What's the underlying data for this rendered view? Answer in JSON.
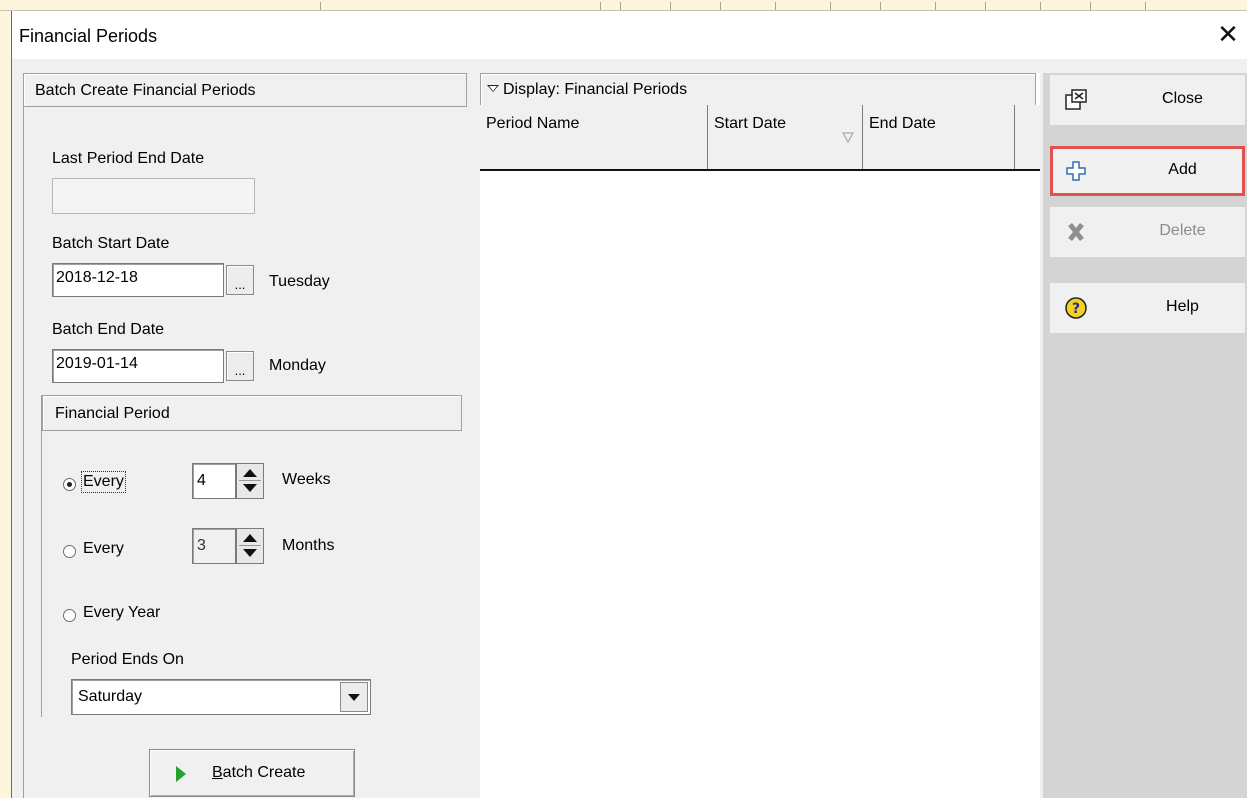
{
  "window": {
    "title": "Financial Periods"
  },
  "left": {
    "header": "Batch Create Financial Periods",
    "last_end_label": "Last Period End Date",
    "last_end_value": "",
    "batch_start_label": "Batch Start Date",
    "batch_start_value": "2018-12-18",
    "batch_start_day": "Tuesday",
    "batch_end_label": "Batch End Date",
    "batch_end_value": "2019-01-14",
    "batch_end_day": "Monday",
    "picker_label": "...",
    "financial_period": {
      "header": "Financial Period",
      "opt1_label": "Every",
      "opt1_value": "4",
      "opt1_unit": "Weeks",
      "opt2_label": "Every",
      "opt2_value": "3",
      "opt2_unit": "Months",
      "opt3_label": "Every Year",
      "selected": "weeks",
      "period_ends_label": "Period Ends On",
      "period_ends_value": "Saturday"
    },
    "batch_button_first": "B",
    "batch_button_rest": "atch Create"
  },
  "display": {
    "header": "Display: Financial Periods",
    "columns": [
      "Period Name",
      "Start Date",
      "End Date"
    ],
    "rows": []
  },
  "actions": {
    "close": "Close",
    "add": "Add",
    "delete": "Delete",
    "help": "Help"
  }
}
